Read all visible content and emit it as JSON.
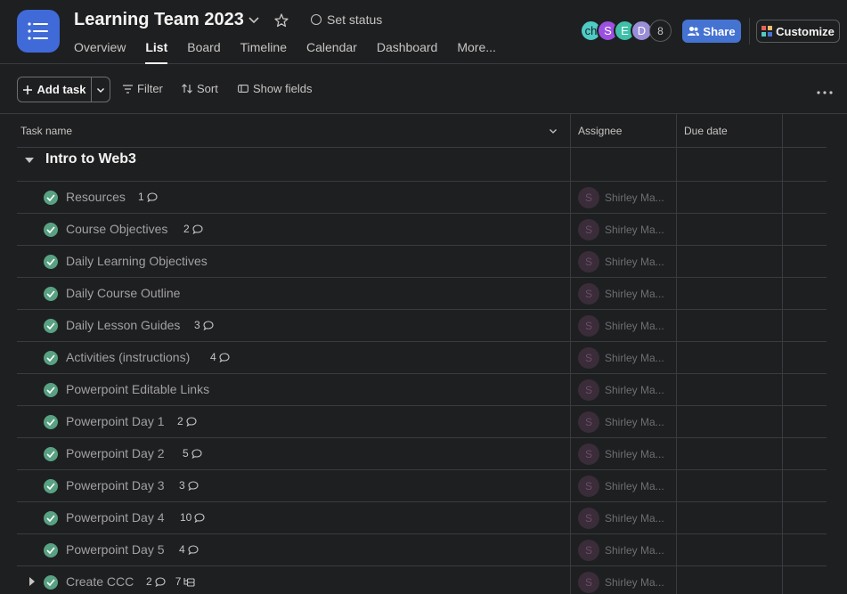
{
  "project": {
    "title": "Learning Team 2023",
    "set_status": "Set status"
  },
  "tabs": [
    "Overview",
    "List",
    "Board",
    "Timeline",
    "Calendar",
    "Dashboard",
    "More..."
  ],
  "active_tab": "List",
  "members": [
    {
      "initials": "ch",
      "color": "#4ecbc4"
    },
    {
      "initials": "S",
      "color": "#9b51e0"
    },
    {
      "initials": "E",
      "color": "#3fbfa8"
    },
    {
      "initials": "D",
      "color": "#9a8ed8"
    }
  ],
  "member_count": "8",
  "header_buttons": {
    "share": "Share",
    "customize": "Customize"
  },
  "toolbar": {
    "add_task": "Add task",
    "filter": "Filter",
    "sort": "Sort",
    "show_fields": "Show fields"
  },
  "columns": {
    "task_name": "Task name",
    "assignee": "Assignee",
    "due_date": "Due date"
  },
  "section": {
    "title": "Intro to Web3"
  },
  "tasks": [
    {
      "name": "Resources",
      "comments": "1",
      "subtasks": ""
    },
    {
      "name": "Course Objectives",
      "comments": "2",
      "subtasks": ""
    },
    {
      "name": "Daily Learning Objectives",
      "comments": "",
      "subtasks": ""
    },
    {
      "name": "Daily Course Outline",
      "comments": "",
      "subtasks": ""
    },
    {
      "name": "Daily Lesson Guides",
      "comments": "3",
      "subtasks": ""
    },
    {
      "name": "Activities (instructions)",
      "comments": "4",
      "subtasks": ""
    },
    {
      "name": "Powerpoint Editable Links",
      "comments": "",
      "subtasks": ""
    },
    {
      "name": "Powerpoint Day 1",
      "comments": "2",
      "subtasks": ""
    },
    {
      "name": "Powerpoint Day 2",
      "comments": "5",
      "subtasks": ""
    },
    {
      "name": "Powerpoint Day 3",
      "comments": "3",
      "subtasks": ""
    },
    {
      "name": "Powerpoint Day 4",
      "comments": "10",
      "subtasks": ""
    },
    {
      "name": "Powerpoint Day 5",
      "comments": "4",
      "subtasks": ""
    },
    {
      "name": "Create CCC",
      "comments": "2",
      "subtasks": "7"
    }
  ],
  "assignee": {
    "initial": "S",
    "name": "Shirley Ma..."
  },
  "colors": {
    "accent": "#4573d2",
    "complete": "#58a182",
    "app_icon": "#3f6ad8"
  }
}
